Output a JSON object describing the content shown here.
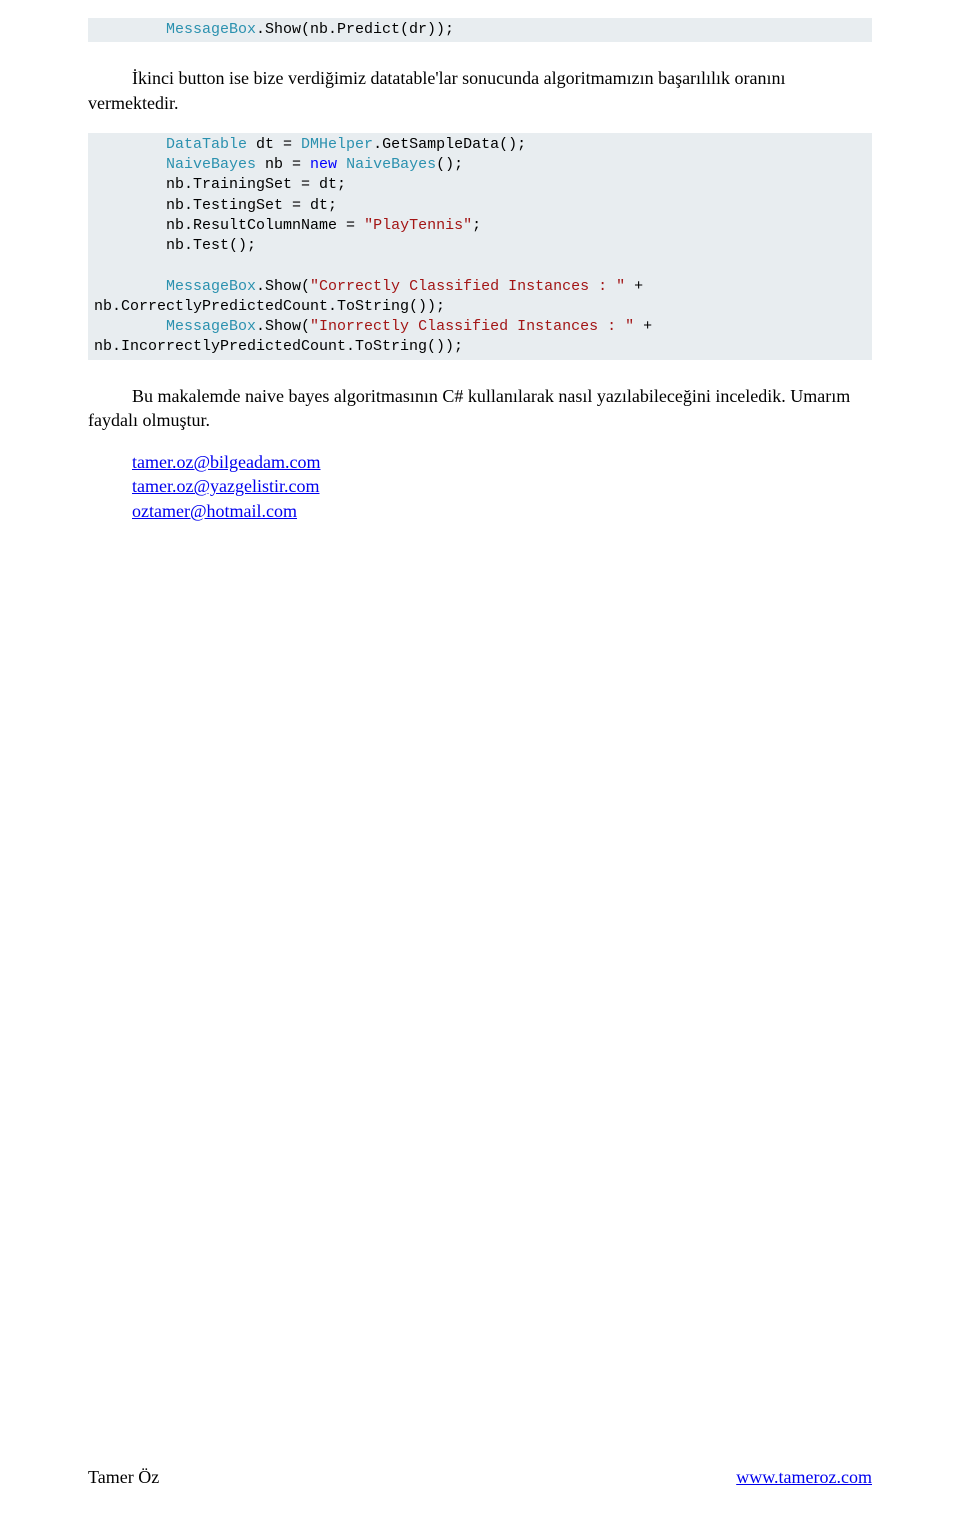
{
  "code1": {
    "prefix": "        ",
    "cls": "MessageBox",
    "rest": ".Show(nb.Predict(dr));"
  },
  "para1": "İkinci button ise bize verdiğimiz datatable'lar sonucunda algoritmamızın başarılılık oranını vermektedir.",
  "code2": {
    "lines": [
      {
        "pre": "        ",
        "a": "DataTable",
        "b": " dt = ",
        "c": "DMHelper",
        "d": ".GetSampleData();"
      },
      {
        "pre": "        ",
        "a": "NaiveBayes",
        "b": " nb = ",
        "kw": "new",
        "c": "NaiveBayes",
        "d": "();",
        " ": " "
      },
      {
        "pre": "        ",
        "t": "nb.TrainingSet = dt;"
      },
      {
        "pre": "        ",
        "t": "nb.TestingSet = dt;"
      },
      {
        "pre": "        ",
        "t1": "nb.ResultColumnName = ",
        "s": "\"PlayTennis\"",
        "t2": ";"
      },
      {
        "pre": "        ",
        "t": "nb.Test();"
      }
    ],
    "msg1": {
      "pre": "        ",
      "cls": "MessageBox",
      "mid": ".Show(",
      "s": "\"Correctly Classified Instances : \"",
      "post": " +"
    },
    "msg1b": "nb.CorrectlyPredictedCount.ToString());",
    "msg2": {
      "pre": "        ",
      "cls": "MessageBox",
      "mid": ".Show(",
      "s": "\"Inorrectly Classified Instances : \"",
      "post": " +"
    },
    "msg2b": "nb.IncorrectlyPredictedCount.ToString());"
  },
  "para2": "Bu makalemde naive bayes algoritmasının C# kullanılarak nasıl yazılabileceğini inceledik. Umarım faydalı olmuştur.",
  "mails": {
    "m1": "tamer.oz@bilgeadam.com",
    "m2": "tamer.oz@yazgelistir.com",
    "m3": "oztamer@hotmail.com"
  },
  "footer": {
    "author": "Tamer Öz",
    "site": "www.tameroz.com"
  }
}
